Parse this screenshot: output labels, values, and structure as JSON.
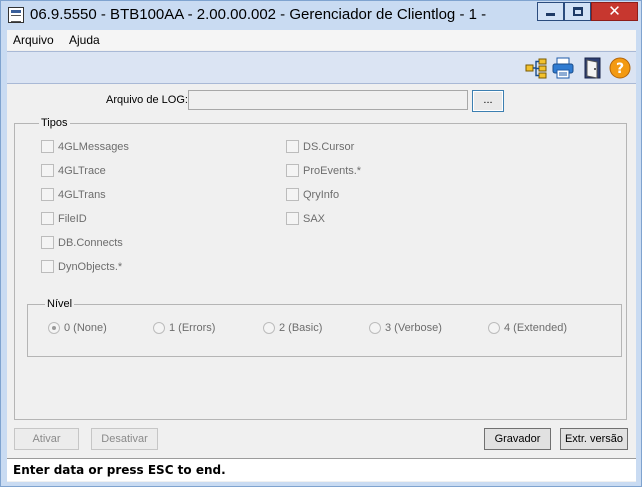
{
  "window": {
    "title": "06.9.5550 - BTB100AA - 2.00.00.002 - Gerenciador de Clientlog - 1 -",
    "close_glyph": "✕"
  },
  "menu": {
    "items": [
      "Arquivo",
      "Ajuda"
    ]
  },
  "toolbar": {
    "icons": [
      "tree-icon",
      "printer-icon",
      "exit-door-icon",
      "help-icon"
    ]
  },
  "file": {
    "label": "Arquivo de LOG:",
    "value": "",
    "browse_label": "..."
  },
  "tipos": {
    "legend": "Tipos",
    "left": [
      "4GLMessages",
      "4GLTrace",
      "4GLTrans",
      "FileID",
      "DB.Connects",
      "DynObjects.*"
    ],
    "right": [
      "DS.Cursor",
      "ProEvents.*",
      "QryInfo",
      "SAX"
    ]
  },
  "nivel": {
    "legend": "Nível",
    "options": [
      "0 (None)",
      "1 (Errors)",
      "2 (Basic)",
      "3 (Verbose)",
      "4 (Extended)"
    ],
    "selected": "0 (None)"
  },
  "buttons": {
    "ativar": "Ativar",
    "desativar": "Desativar",
    "gravador": "Gravador",
    "extr": "Extr. versão"
  },
  "status": {
    "text": "Enter data or press ESC to end."
  },
  "colors": {
    "title_bar": "#c9dbf2",
    "close_button": "#c7372f"
  }
}
